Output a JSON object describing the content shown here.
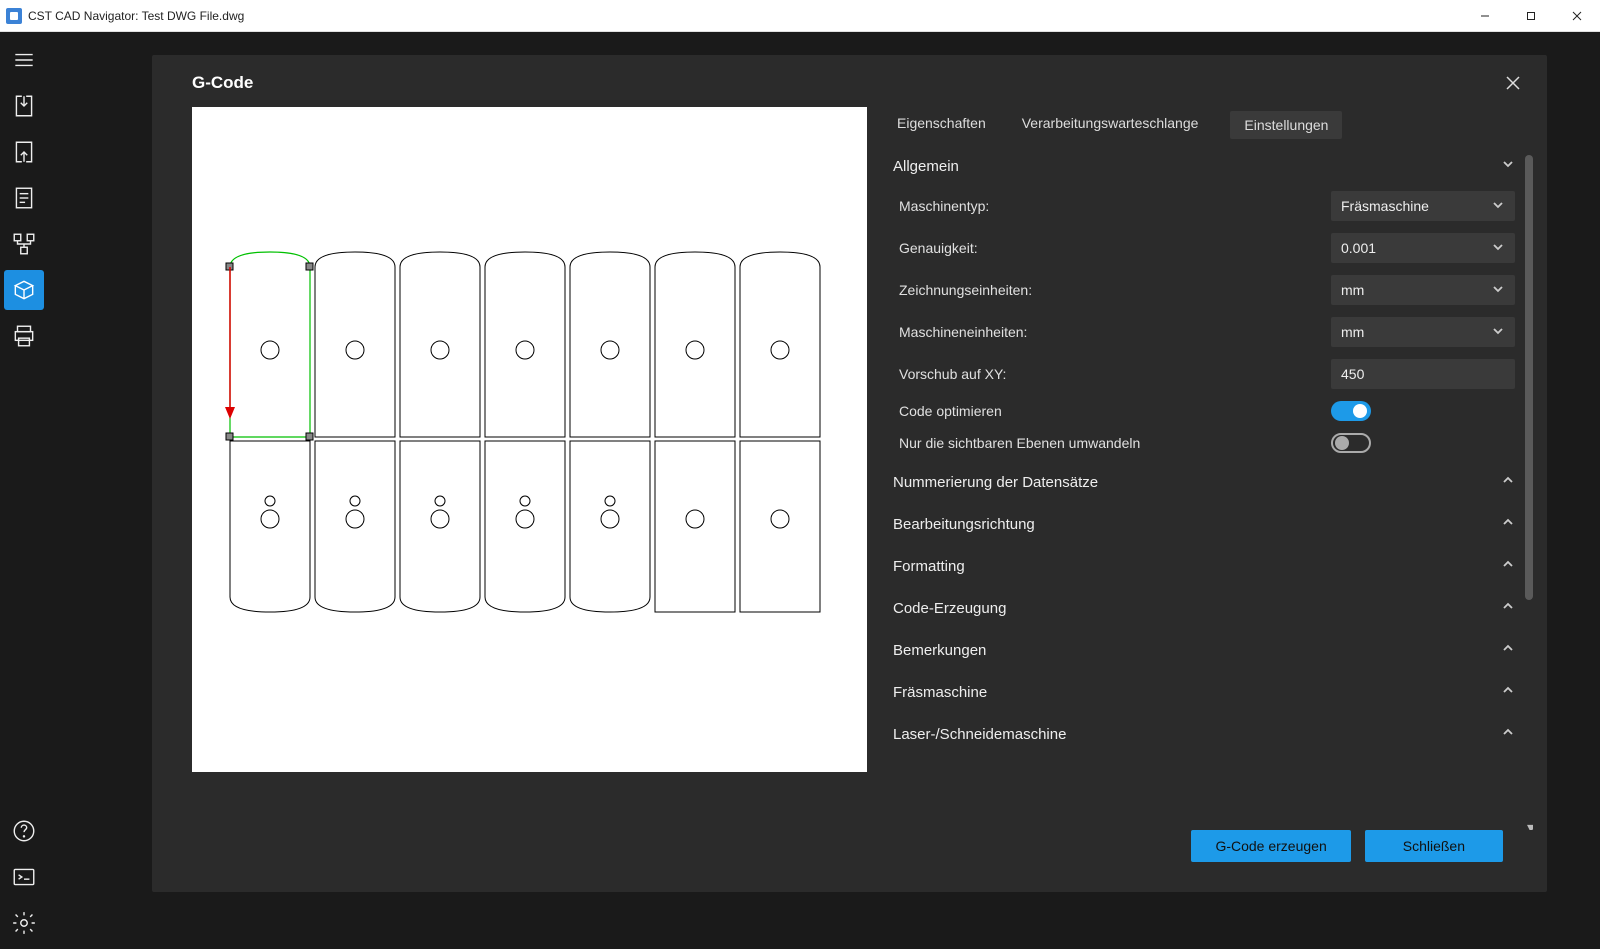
{
  "window": {
    "title": "CST CAD Navigator: Test DWG File.dwg"
  },
  "sidebar": {
    "items": [
      {
        "name": "hamburger"
      },
      {
        "name": "import"
      },
      {
        "name": "export"
      },
      {
        "name": "document"
      },
      {
        "name": "tree"
      },
      {
        "name": "gcode"
      },
      {
        "name": "print"
      }
    ],
    "bottom_items": [
      {
        "name": "help"
      },
      {
        "name": "console"
      },
      {
        "name": "settings"
      }
    ]
  },
  "dialog": {
    "title": "G-Code",
    "tabs": {
      "properties": "Eigenschaften",
      "queue": "Verarbeitungswarteschlange",
      "settings": "Einstellungen"
    },
    "sections": {
      "general": "Allgemein",
      "numbering": "Nummerierung der Datensätze",
      "direction": "Bearbeitungsrichtung",
      "formatting": "Formatting",
      "codegen": "Code-Erzeugung",
      "remarks": "Bemerkungen",
      "milling": "Fräsmaschine",
      "laser": "Laser-/Schneidemaschine"
    },
    "fields": {
      "machine_type": {
        "label": "Maschinentyp:",
        "value": "Fräsmaschine"
      },
      "precision": {
        "label": "Genauigkeit:",
        "value": "0.001"
      },
      "drawing_units": {
        "label": "Zeichnungseinheiten:",
        "value": "mm"
      },
      "machine_units": {
        "label": "Maschineneinheiten:",
        "value": "mm"
      },
      "feed_xy": {
        "label": "Vorschub auf XY:",
        "value": "450"
      },
      "optimize": {
        "label": "Code optimieren",
        "value": true
      },
      "visible_only": {
        "label": "Nur die sichtbaren Ebenen umwandeln",
        "value": false
      }
    },
    "buttons": {
      "generate": "G-Code erzeugen",
      "close": "Schließen"
    }
  }
}
